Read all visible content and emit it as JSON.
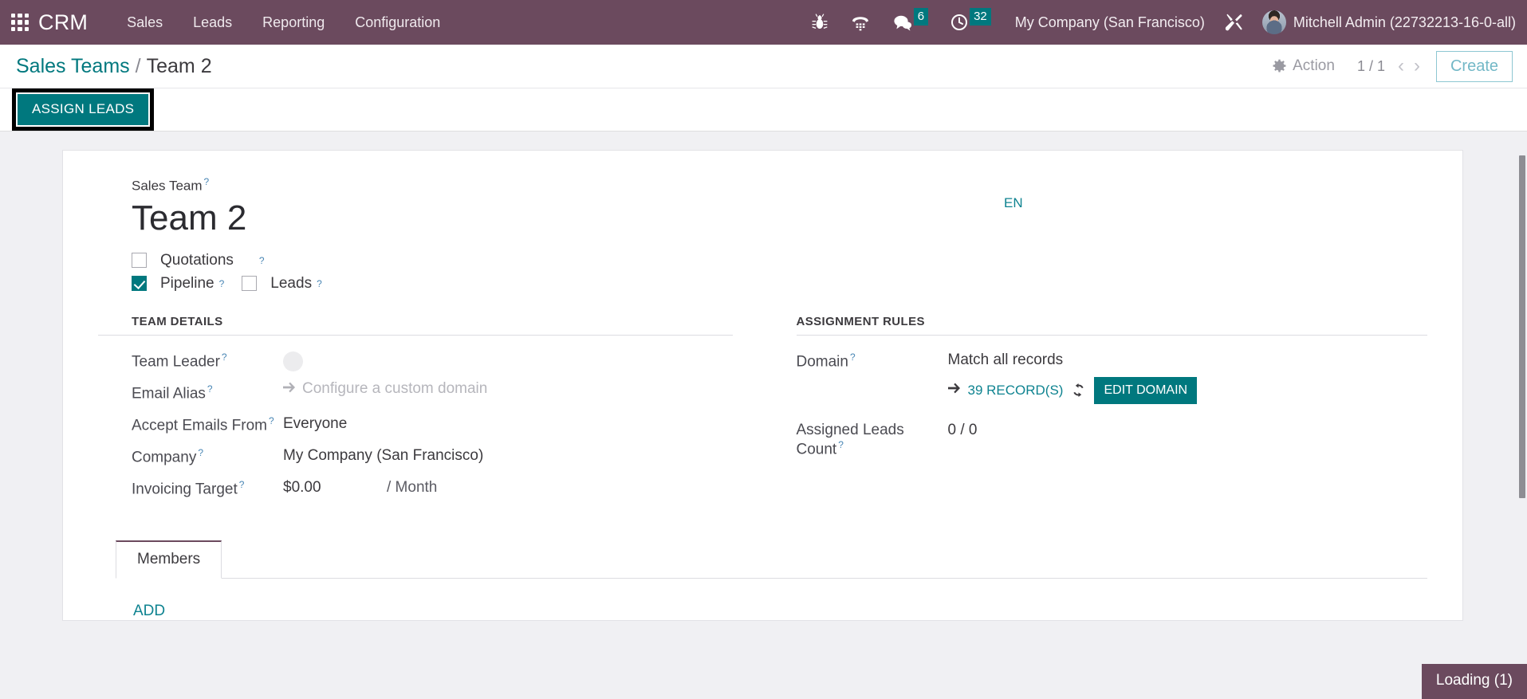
{
  "navbar": {
    "apps_icon": "apps-grid-icon",
    "brand": "CRM",
    "menu": [
      {
        "label": "Sales"
      },
      {
        "label": "Leads"
      },
      {
        "label": "Reporting"
      },
      {
        "label": "Configuration"
      }
    ],
    "sys_icons": [
      {
        "name": "bug-icon",
        "badge": ""
      },
      {
        "name": "phone-dialpad-icon",
        "badge": ""
      },
      {
        "name": "messages-icon",
        "badge": "6"
      },
      {
        "name": "activities-clock-icon",
        "badge": "32"
      }
    ],
    "company": "My Company (San Francisco)",
    "tools_icon": "tools-wrench-icon",
    "user": "Mitchell Admin (22732213-16-0-all)"
  },
  "control_panel": {
    "breadcrumb_root": "Sales Teams",
    "breadcrumb_sep": "/",
    "breadcrumb_current": "Team 2",
    "action_label": "Action",
    "pager": "1 / 1",
    "prev_arrow": "‹",
    "next_arrow": "›",
    "create_label": "Create",
    "assign_leads_label": "ASSIGN LEADS"
  },
  "form": {
    "sales_team_label": "Sales Team",
    "record_title": "Team 2",
    "lang_badge": "EN",
    "checkboxes": [
      {
        "label": "Quotations",
        "checked": false
      },
      {
        "label": "Pipeline",
        "checked": true
      },
      {
        "label": "Leads",
        "checked": false
      }
    ],
    "team_details": {
      "title": "TEAM DETAILS",
      "rows": [
        {
          "label": "Team Leader",
          "value": ""
        },
        {
          "label": "Email Alias",
          "value": "Configure a custom domain"
        },
        {
          "label": "Accept Emails From",
          "value": "Everyone"
        },
        {
          "label": "Company",
          "value": "My Company (San Francisco)"
        },
        {
          "label": "Invoicing Target",
          "value": "$0.00",
          "unit": "/ Month"
        }
      ]
    },
    "assignment_rules": {
      "title": "ASSIGNMENT RULES",
      "domain_label": "Domain",
      "domain_value": "Match all records",
      "records_link": "39 RECORD(S)",
      "edit_domain_label": "EDIT DOMAIN",
      "assigned_label": "Assigned Leads Count",
      "assigned_value": "0 / 0"
    },
    "notebook": {
      "tabs": [
        {
          "label": "Members",
          "active": true
        }
      ],
      "add_label": "ADD"
    }
  },
  "status": {
    "loading": "Loading (1)"
  },
  "colors": {
    "navbar": "#6b4a5e",
    "accent_teal": "#00787e",
    "link_teal": "#0e8390",
    "badge": "#00787e"
  }
}
